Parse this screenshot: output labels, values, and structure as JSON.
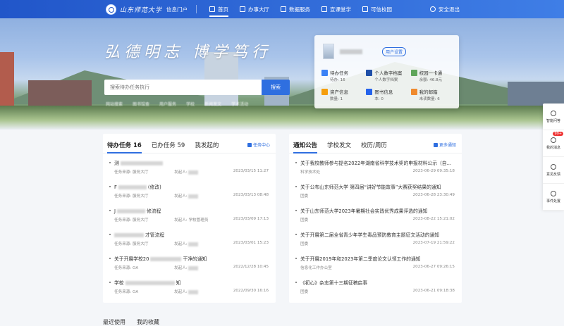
{
  "header": {
    "school_name": "山东师范大学",
    "portal_label": "信息门户",
    "nav": [
      {
        "label": "首页",
        "active": true
      },
      {
        "label": "办事大厅"
      },
      {
        "label": "数据服务"
      },
      {
        "label": "宣课堂学"
      },
      {
        "label": "可信校园"
      }
    ],
    "logout": "安全退出"
  },
  "banner": {
    "slogan": "弘德明志 博学笃行",
    "search_placeholder": "搜索待办任务执行",
    "search_button": "搜索",
    "quick_links": [
      "网站搜索",
      "图书馆查",
      "用户服务",
      "学校",
      "新闻发文",
      "学术活动"
    ]
  },
  "user_card": {
    "settings_label": "用户设置",
    "items": [
      {
        "title": "待办任务",
        "value": "待办: 16",
        "color": "#3b82f6"
      },
      {
        "title": "个人数字档案",
        "value": "个人数字档案",
        "color": "#1f4fa8"
      },
      {
        "title": "校园一卡通",
        "value": "余额: 46.8元",
        "color": "#5fa55a"
      },
      {
        "title": "资产信息",
        "value": "数量: 1",
        "color": "#f59e0b"
      },
      {
        "title": "图书信息",
        "value": "本: 0",
        "color": "#2563eb"
      },
      {
        "title": "我的邮箱",
        "value": "未读数量: 6",
        "color": "#ef8a2e"
      }
    ]
  },
  "float_bar": [
    {
      "label": "智能问答",
      "icon": "robot-icon"
    },
    {
      "label": "我的消息",
      "icon": "bell-icon",
      "badge": "99+"
    },
    {
      "label": "意见反馈",
      "icon": "feedback-icon"
    },
    {
      "label": "事件处置",
      "icon": "mail-icon"
    }
  ],
  "tasks": {
    "tabs": [
      "待办任务 16",
      "已办任务 59",
      "我发起的"
    ],
    "link": "任务中心",
    "rows": [
      {
        "title": "测",
        "source": "任务来源: 服务大厅",
        "initiator": "发起人: ",
        "date": "2023/03/15 11:27"
      },
      {
        "title": "F",
        "title_tail": "(修改)",
        "source": "任务来源: 服务大厅",
        "initiator": "发起人: ",
        "date": "2023/03/13 08:48"
      },
      {
        "title": "J",
        "title_tail": "修流程",
        "source": "任务来源: 服务大厅",
        "initiator": "发起人: 学校管理员",
        "date": "2023/03/09 17:13"
      },
      {
        "title": "",
        "title_tail": "才管流程",
        "source": "任务来源: 服务大厅",
        "initiator": "发起人: ",
        "date": "2023/03/01 15:23"
      },
      {
        "title": "关于开展学校20",
        "title_tail": "干净的通知",
        "source": "任务来源: OA",
        "initiator": "发起人: ",
        "date": "2022/12/28 10:45"
      },
      {
        "title": "学校",
        "title_tail": "知",
        "source": "任务来源: OA",
        "initiator": "发起人: ",
        "date": "2022/09/30 16:16"
      }
    ]
  },
  "notices": {
    "tabs": [
      "通知公告",
      "学校发文",
      "校历/周历"
    ],
    "link": "更多通知",
    "rows": [
      {
        "title": "关于我校教师参与提名2022年湖南省科学技术奖的申报材料公示（自...",
        "source": "科学技术处",
        "date": "2023-06-29 09:35:18"
      },
      {
        "title": "关于公布山东师范大学 第四届“讲好节能故事”大赛获奖结果的通知",
        "source": "团委",
        "date": "2023-06-28 23:30:49"
      },
      {
        "title": "关于山东师范大学2023年暑期社会实践优秀成果评选的通知",
        "source": "团委",
        "date": "2023-08-22 15:21:02"
      },
      {
        "title": "关于开展第二届全省青少年学生毒品预防教育主题征文活动的通知",
        "source": "团委",
        "date": "2023-07-19 21:59:22"
      },
      {
        "title": "关于开展2019年和2023年第二季度论文认领工作的通知",
        "source": "信息化工作办公室",
        "date": "2023-06-27 09:26:15"
      },
      {
        "title": "《初心》杂志第十三期征稿启事",
        "source": "团委",
        "date": "2023-06-21 09:18:38"
      }
    ]
  },
  "bottom_tabs": [
    "最近使用",
    "我的收藏"
  ]
}
